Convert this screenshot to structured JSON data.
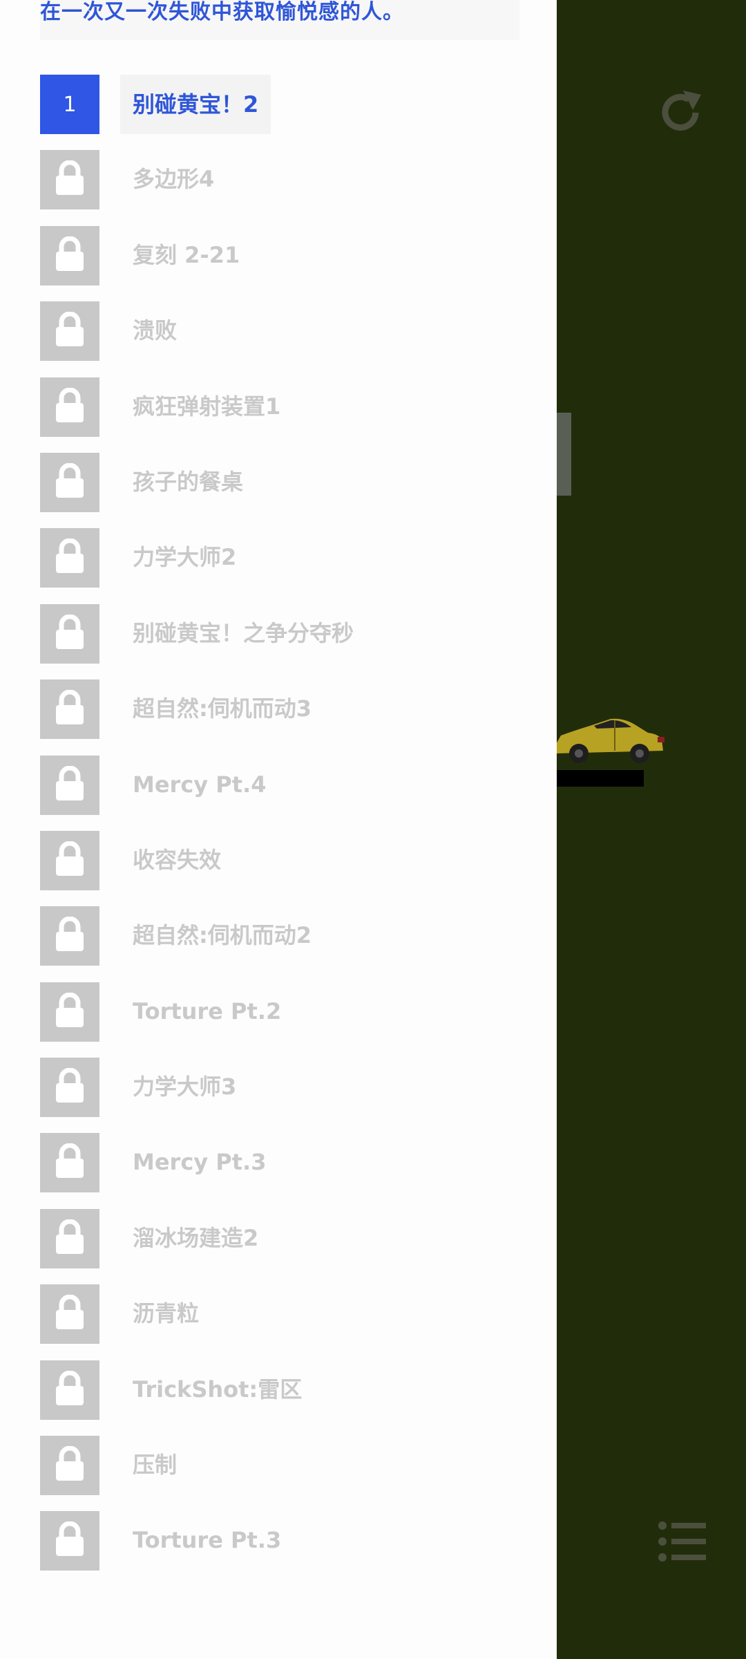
{
  "header": {
    "text": "在一次又一次失败中获取愉悦感的人。"
  },
  "current_level": {
    "number": "1",
    "title": "别碰黄宝！2"
  },
  "levels": [
    {
      "title": "多边形4",
      "locked": true
    },
    {
      "title": "复刻 2-21",
      "locked": true
    },
    {
      "title": "溃败",
      "locked": true
    },
    {
      "title": "疯狂弹射装置1",
      "locked": true
    },
    {
      "title": "孩子的餐桌",
      "locked": true
    },
    {
      "title": "力学大师2",
      "locked": true
    },
    {
      "title": "别碰黄宝！之争分夺秒",
      "locked": true
    },
    {
      "title": "超自然:伺机而动3",
      "locked": true
    },
    {
      "title": "Mercy Pt.4",
      "locked": true
    },
    {
      "title": "收容失效",
      "locked": true
    },
    {
      "title": "超自然:伺机而动2",
      "locked": true
    },
    {
      "title": "Torture Pt.2",
      "locked": true
    },
    {
      "title": "力学大师3",
      "locked": true
    },
    {
      "title": "Mercy Pt.3",
      "locked": true
    },
    {
      "title": "溜冰场建造2",
      "locked": true
    },
    {
      "title": "沥青粒",
      "locked": true
    },
    {
      "title": "TrickShot:雷区",
      "locked": true
    },
    {
      "title": "压制",
      "locked": true
    },
    {
      "title": "Torture Pt.3",
      "locked": true
    }
  ],
  "icons": {
    "restart": "restart-icon",
    "menu": "list-menu-icon",
    "lock": "lock-icon"
  },
  "colors": {
    "accent": "#2f56e4",
    "game_background": "#212d0a",
    "locked_tile": "#c8c8c8",
    "locked_text": "#c9c9c9",
    "car_body": "#b8a224"
  }
}
